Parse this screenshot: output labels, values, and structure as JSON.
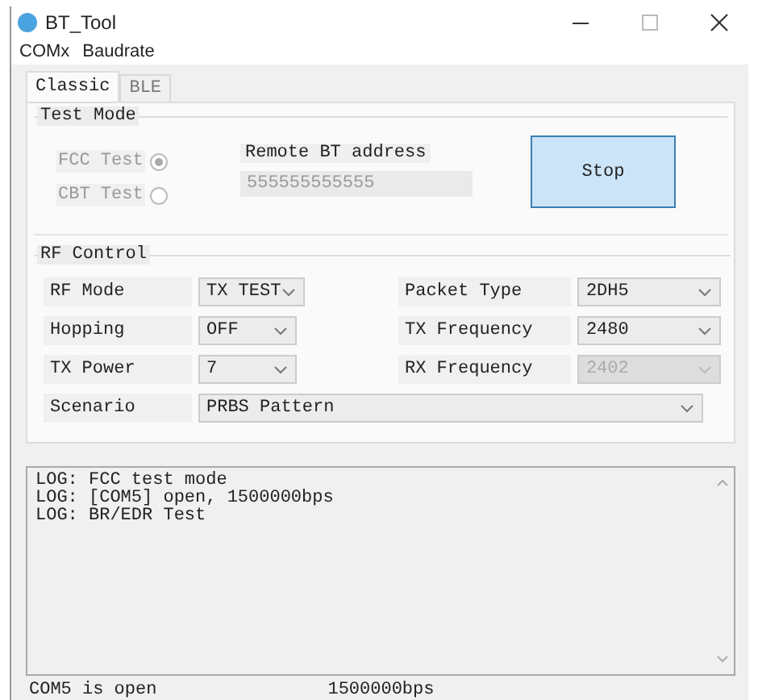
{
  "window": {
    "title": "BT_Tool"
  },
  "menu": [
    {
      "label": "COMx"
    },
    {
      "label": "Baudrate"
    }
  ],
  "tabs": [
    {
      "label": "Classic",
      "selected": true
    },
    {
      "label": "BLE",
      "selected": false
    }
  ],
  "test_mode": {
    "title": "Test Mode",
    "radios": [
      {
        "label": "FCC Test",
        "selected": true,
        "disabled": true
      },
      {
        "label": "CBT Test",
        "selected": false,
        "disabled": true
      }
    ],
    "address_label": "Remote BT address",
    "address_value": "555555555555",
    "button": "Stop"
  },
  "rf_control": {
    "title": "RF Control",
    "fields": [
      {
        "label": "RF Mode",
        "value": "TX TEST",
        "disabled": false
      },
      {
        "label": "Packet Type",
        "value": "2DH5",
        "disabled": false
      },
      {
        "label": "Hopping",
        "value": "OFF",
        "disabled": false
      },
      {
        "label": "TX Frequency",
        "value": "2480",
        "disabled": false
      },
      {
        "label": "TX Power",
        "value": "7",
        "disabled": false
      },
      {
        "label": "RX Frequency",
        "value": "2402",
        "disabled": true
      },
      {
        "label": "Scenario",
        "value": "PRBS Pattern",
        "disabled": false
      }
    ]
  },
  "log": [
    "LOG: FCC test mode",
    "LOG: [COM5] open, 1500000bps",
    "LOG: BR/EDR Test"
  ],
  "status_bar": [
    "COM5 is open",
    "1500000bps"
  ]
}
